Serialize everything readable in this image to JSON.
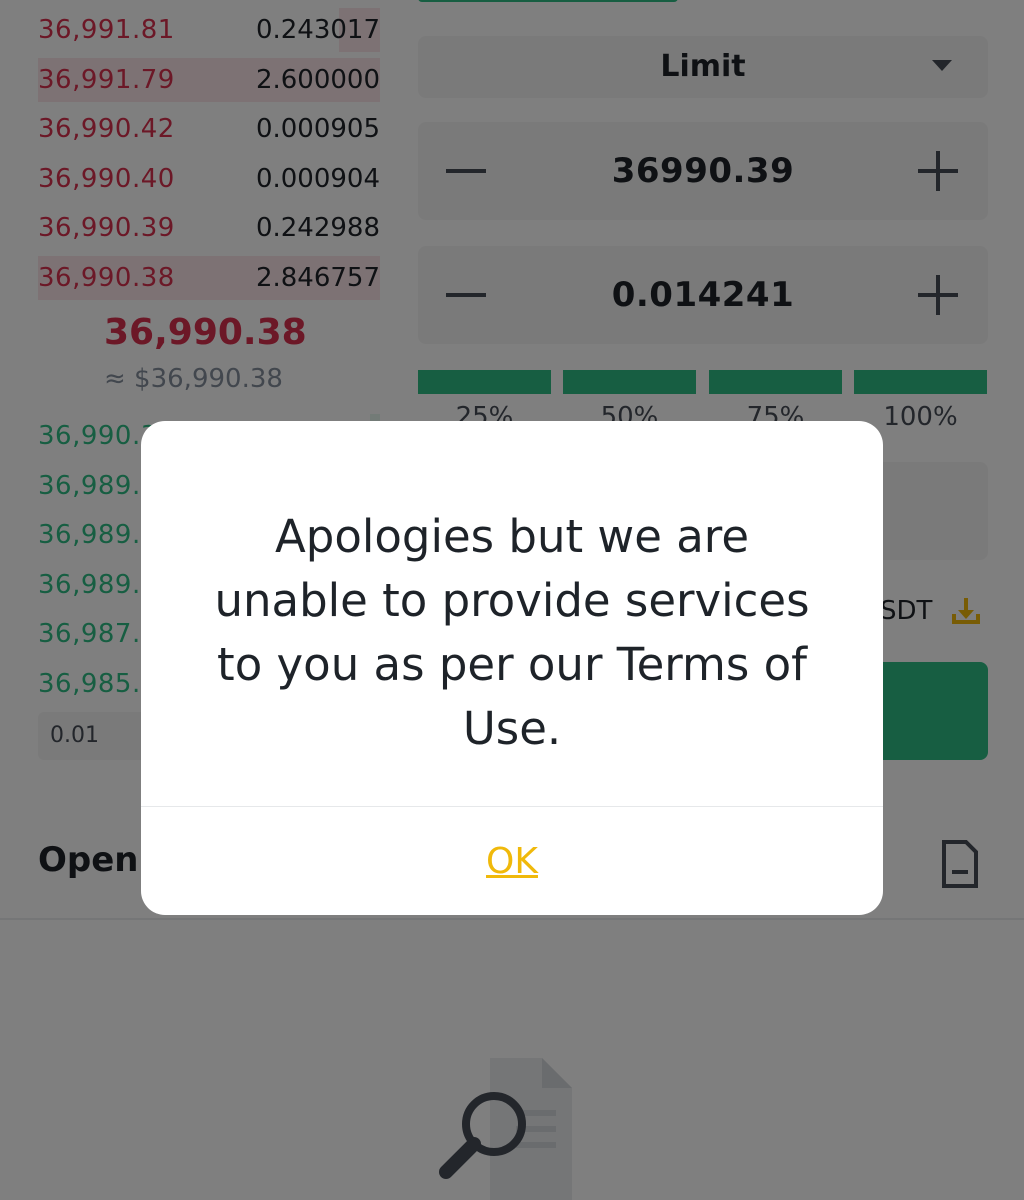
{
  "order_book": {
    "asks": [
      {
        "price": "36,991.81",
        "amount": "0.243017",
        "depth": 0.12
      },
      {
        "price": "36,991.79",
        "amount": "2.600000",
        "depth": 1.0
      },
      {
        "price": "36,990.42",
        "amount": "0.000905",
        "depth": 0.0
      },
      {
        "price": "36,990.40",
        "amount": "0.000904",
        "depth": 0.0
      },
      {
        "price": "36,990.39",
        "amount": "0.242988",
        "depth": 0.0
      },
      {
        "price": "36,990.38",
        "amount": "2.846757",
        "depth": 1.0
      }
    ],
    "last_price": "36,990.38",
    "last_price_usd": "≈ $36,990.38",
    "bids": [
      {
        "price": "36,990.3",
        "depth": 0.03
      },
      {
        "price": "36,989.8",
        "depth": 0.0
      },
      {
        "price": "36,989.8",
        "depth": 0.0
      },
      {
        "price": "36,989.8",
        "depth": 0.0
      },
      {
        "price": "36,987.2",
        "depth": 0.0
      },
      {
        "price": "36,985.1",
        "depth": 0.0
      }
    ],
    "precision": "0.01"
  },
  "order_form": {
    "order_type": "Limit",
    "price": "36990.39",
    "amount": "0.014241",
    "percent_options": [
      "25%",
      "50%",
      "75%",
      "100%"
    ],
    "available_unit": "SDT"
  },
  "open_orders": {
    "title": "Open"
  },
  "dialog": {
    "message": "Apologies but we are unable to provide services to you as per our Terms of Use.",
    "ok_label": "OK"
  },
  "colors": {
    "ask": "#d9304e",
    "bid": "#2ebd85",
    "accent": "#f0b90b"
  }
}
